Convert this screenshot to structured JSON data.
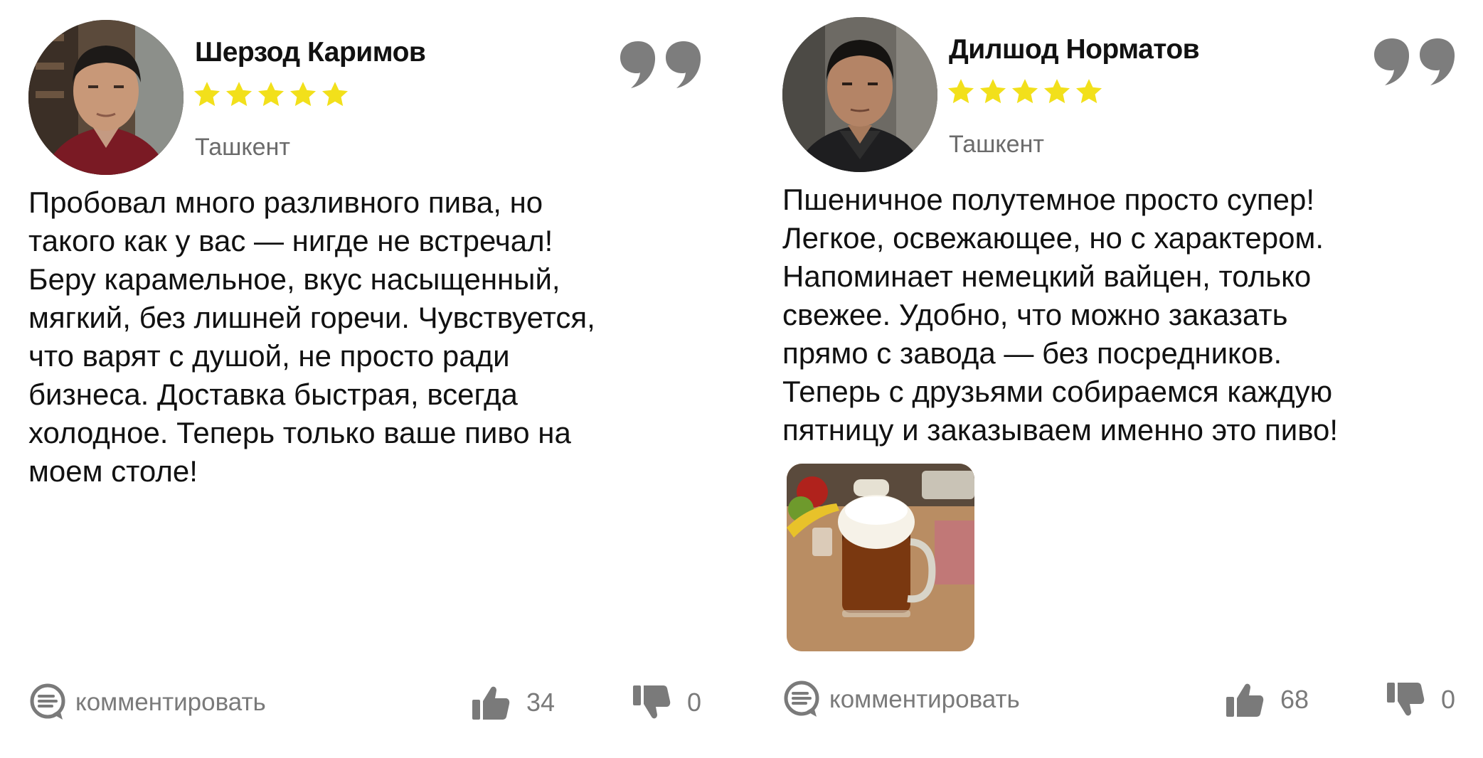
{
  "reviews": [
    {
      "author": "Шерзод Каримов",
      "rating": 5,
      "city": "Ташкент",
      "text": "Пробовал много разливного пива, но\nтакого как у вас — нигде не встречал!\nБеру карамельное, вкус насыщенный,\nмягкий, без лишней горечи. Чувствуется,\nчто варят с душой, не просто ради\nбизнеса. Доставка быстрая, всегда\nхолодное. Теперь только ваше пиво на\nмоем столе!",
      "comment_label": "комментировать",
      "likes": "34",
      "dislikes": "0"
    },
    {
      "author": "Дилшод Норматов",
      "rating": 5,
      "city": "Ташкент",
      "text": "Пшеничное полутемное просто супер!\nЛегкое, освежающее, но с характером.\nНапоминает немецкий вайцен, только\nсвежее. Удобно, что можно заказать\nпрямо с завода — без посредников.\nТеперь с друзьями собираемся каждую\nпятницу и заказываем именно это пиво!",
      "comment_label": "комментировать",
      "likes": "68",
      "dislikes": "0"
    }
  ],
  "colors": {
    "star": "#f2e01b",
    "quote": "#7d7d7d",
    "muted_text": "#7a7a7a",
    "text": "#111111"
  },
  "icons": {
    "quote": "quote-icon",
    "star": "star-icon",
    "comment": "comment-bubble-icon",
    "like": "thumbs-up-icon",
    "dislike": "thumbs-down-icon"
  }
}
